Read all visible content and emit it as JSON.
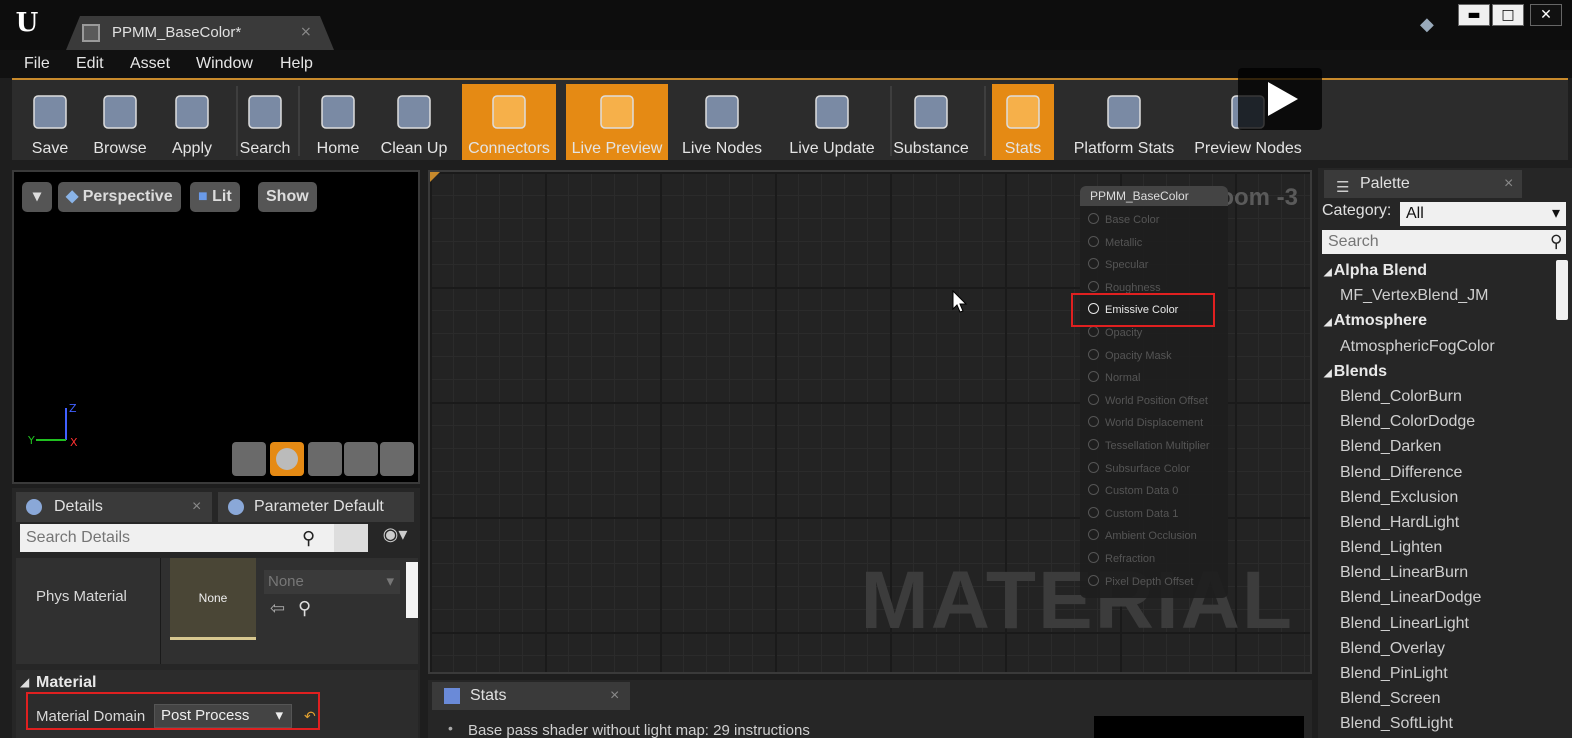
{
  "window": {
    "tab_title": "PPMM_BaseColor*",
    "tab_close": "×",
    "controls": {
      "minimize": "▬",
      "maximize": "□",
      "close": "✕"
    }
  },
  "menu": [
    "File",
    "Edit",
    "Asset",
    "Window",
    "Help"
  ],
  "toolbar": [
    {
      "label": "Save",
      "icon": "save-icon",
      "active": false
    },
    {
      "label": "Browse",
      "icon": "magnifier-icon",
      "active": false
    },
    {
      "label": "Apply",
      "icon": "checkmark-icon",
      "active": false
    },
    {
      "label": "Search",
      "icon": "binoculars-icon",
      "active": false
    },
    {
      "label": "Home",
      "icon": "home-icon",
      "active": false
    },
    {
      "label": "Clean Up",
      "icon": "broom-icon",
      "active": false
    },
    {
      "label": "Connectors",
      "icon": "connectors-icon",
      "active": true
    },
    {
      "label": "Live Preview",
      "icon": "tv-icon",
      "active": true
    },
    {
      "label": "Live Nodes",
      "icon": "live-nodes-icon",
      "active": false
    },
    {
      "label": "Live Update",
      "icon": "live-update-icon",
      "active": false
    },
    {
      "label": "Substance",
      "icon": "substance-icon",
      "active": false
    },
    {
      "label": "Stats",
      "icon": "stats-icon",
      "active": true
    },
    {
      "label": "Platform Stats",
      "icon": "platform-stats-icon",
      "active": false
    },
    {
      "label": "Preview Nodes",
      "icon": "preview-nodes-icon",
      "active": false
    }
  ],
  "viewport": {
    "perspective": "Perspective",
    "lit": "Lit",
    "show": "Show",
    "axis_z": "Z",
    "axis_y": "Y",
    "axis_x": "X"
  },
  "details": {
    "tab_details": "Details",
    "tab_params": "Parameter Default",
    "tab_close": "×",
    "search_placeholder": "Search Details",
    "phys_material_label": "Phys Material",
    "phys_material_thumb": "None",
    "phys_material_value": "None",
    "section_material": "Material",
    "material_domain_label": "Material Domain",
    "material_domain_value": "Post Process"
  },
  "graph": {
    "zoom": "Zoom -3",
    "watermark": "MATERIAL",
    "node_title": "PPMM_BaseColor",
    "pins": [
      "Base Color",
      "Metallic",
      "Specular",
      "Roughness",
      "Emissive Color",
      "Opacity",
      "Opacity Mask",
      "Normal",
      "World Position Offset",
      "World Displacement",
      "Tessellation Multiplier",
      "Subsurface Color",
      "Custom Data 0",
      "Custom Data 1",
      "Ambient Occlusion",
      "Refraction",
      "Pixel Depth Offset"
    ],
    "active_pin": "Emissive Color"
  },
  "stats": {
    "tab": "Stats",
    "tab_close": "×",
    "line": "Base pass shader without light map: 29 instructions"
  },
  "palette": {
    "tab": "Palette",
    "tab_close": "×",
    "category_label": "Category:",
    "category_value": "All",
    "search_placeholder": "Search",
    "items": [
      {
        "text": "Alpha Blend",
        "kind": "cat"
      },
      {
        "text": "MF_VertexBlend_JM",
        "kind": "item"
      },
      {
        "text": "Atmosphere",
        "kind": "cat"
      },
      {
        "text": "AtmosphericFogColor",
        "kind": "item"
      },
      {
        "text": "Blends",
        "kind": "cat"
      },
      {
        "text": "Blend_ColorBurn",
        "kind": "item"
      },
      {
        "text": "Blend_ColorDodge",
        "kind": "item"
      },
      {
        "text": "Blend_Darken",
        "kind": "item"
      },
      {
        "text": "Blend_Difference",
        "kind": "item"
      },
      {
        "text": "Blend_Exclusion",
        "kind": "item"
      },
      {
        "text": "Blend_HardLight",
        "kind": "item"
      },
      {
        "text": "Blend_Lighten",
        "kind": "item"
      },
      {
        "text": "Blend_LinearBurn",
        "kind": "item"
      },
      {
        "text": "Blend_LinearDodge",
        "kind": "item"
      },
      {
        "text": "Blend_LinearLight",
        "kind": "item"
      },
      {
        "text": "Blend_Overlay",
        "kind": "item"
      },
      {
        "text": "Blend_PinLight",
        "kind": "item"
      },
      {
        "text": "Blend_Screen",
        "kind": "item"
      },
      {
        "text": "Blend_SoftLight",
        "kind": "item"
      }
    ]
  },
  "colors": {
    "accent": "#e58a14",
    "highlight": "#e02020",
    "panel": "#262626"
  }
}
